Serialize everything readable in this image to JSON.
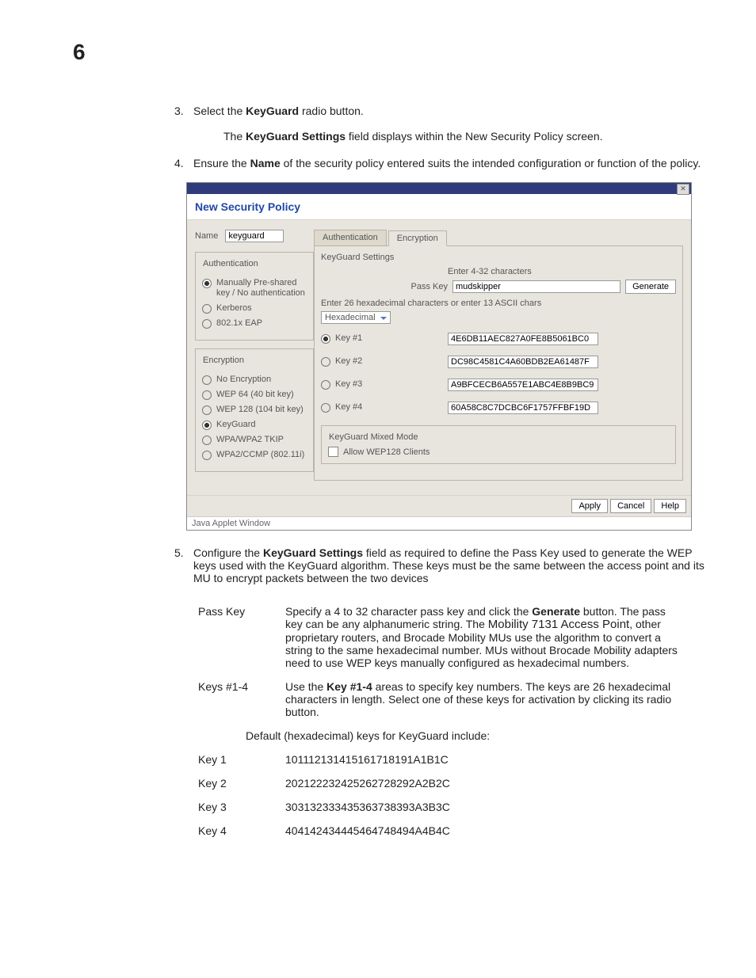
{
  "pageNumber": "6",
  "steps": {
    "s3": {
      "num": "3.",
      "pre": "Select the ",
      "bold": "KeyGuard",
      "post": " radio button."
    },
    "s3sub": {
      "pre": "The ",
      "bold": "KeyGuard Settings",
      "post": " field displays within the New Security Policy screen."
    },
    "s4": {
      "num": "4.",
      "pre": "Ensure the ",
      "bold": "Name",
      "post": " of the security policy entered suits the intended configuration or function of the policy."
    },
    "s5": {
      "num": "5.",
      "pre": "Configure the ",
      "bold": "KeyGuard Settings",
      "post": " field as required to define the Pass Key used to generate the WEP keys used with the KeyGuard algorithm. These keys must be the same between the access point and its MU to encrypt packets between the two devices"
    }
  },
  "shot": {
    "title": "New Security Policy",
    "nameLabel": "Name",
    "nameValue": "keyguard",
    "authGroup": "Authentication",
    "authOpts": [
      "Manually Pre-shared key / No authentication",
      "Kerberos",
      "802.1x EAP"
    ],
    "encGroup": "Encryption",
    "encOpts": [
      "No Encryption",
      "WEP 64 (40 bit key)",
      "WEP 128 (104 bit key)",
      "KeyGuard",
      "WPA/WPA2 TKIP",
      "WPA2/CCMP (802.11i)"
    ],
    "tabAuth": "Authentication",
    "tabEnc": "Encryption",
    "kgTitle": "KeyGuard Settings",
    "enterChars": "Enter 4-32 characters",
    "passKeyLabel": "Pass Key",
    "passKeyValue": "mudskipper",
    "generate": "Generate",
    "hexNote": "Enter 26 hexadecimal characters or enter 13 ASCII chars",
    "hexSel": "Hexadecimal",
    "keys": [
      {
        "label": "Key #1",
        "val": "4E6DB11AEC827A0FE8B5061BC0"
      },
      {
        "label": "Key #2",
        "val": "DC98C4581C4A60BDB2EA61487F"
      },
      {
        "label": "Key #3",
        "val": "A9BFCECB6A557E1ABC4E8B9BC9"
      },
      {
        "label": "Key #4",
        "val": "60A58C8C7DCBC6F1757FFBF19D"
      }
    ],
    "mixedTitle": "KeyGuard Mixed Mode",
    "allowWep": "Allow WEP128 Clients",
    "apply": "Apply",
    "cancel": "Cancel",
    "help": "Help",
    "javaNote": "Java Applet Window"
  },
  "defs": {
    "passKey": {
      "term": "Pass Key",
      "t1": "Specify a 4 to 32 character pass key and click the ",
      "b1": "Generate",
      "t2": " button. The pass key can be any alphanumeric string. The ",
      "b2": "Mobility 7131 Access Point",
      "t3": ", other proprietary routers, and Brocade Mobility MUs use the algorithm to convert a string to the same hexadecimal number. MUs without Brocade Mobility adapters need to use WEP keys manually configured as hexadecimal numbers."
    },
    "keys14": {
      "term": "Keys #1-4",
      "t1": "Use the ",
      "b1": "Key #1-4",
      "t2": " areas to specify key numbers. The keys are 26 hexadecimal characters in length. Select one of these keys for activation by clicking its radio button."
    }
  },
  "defaultNote": "Default (hexadecimal) keys for KeyGuard include:",
  "defkeys": [
    {
      "k": "Key 1",
      "v": "101112131415161718191A1B1C"
    },
    {
      "k": "Key 2",
      "v": "202122232425262728292A2B2C"
    },
    {
      "k": "Key 3",
      "v": "303132333435363738393A3B3C"
    },
    {
      "k": "Key 4",
      "v": "404142434445464748494A4B4C"
    }
  ]
}
